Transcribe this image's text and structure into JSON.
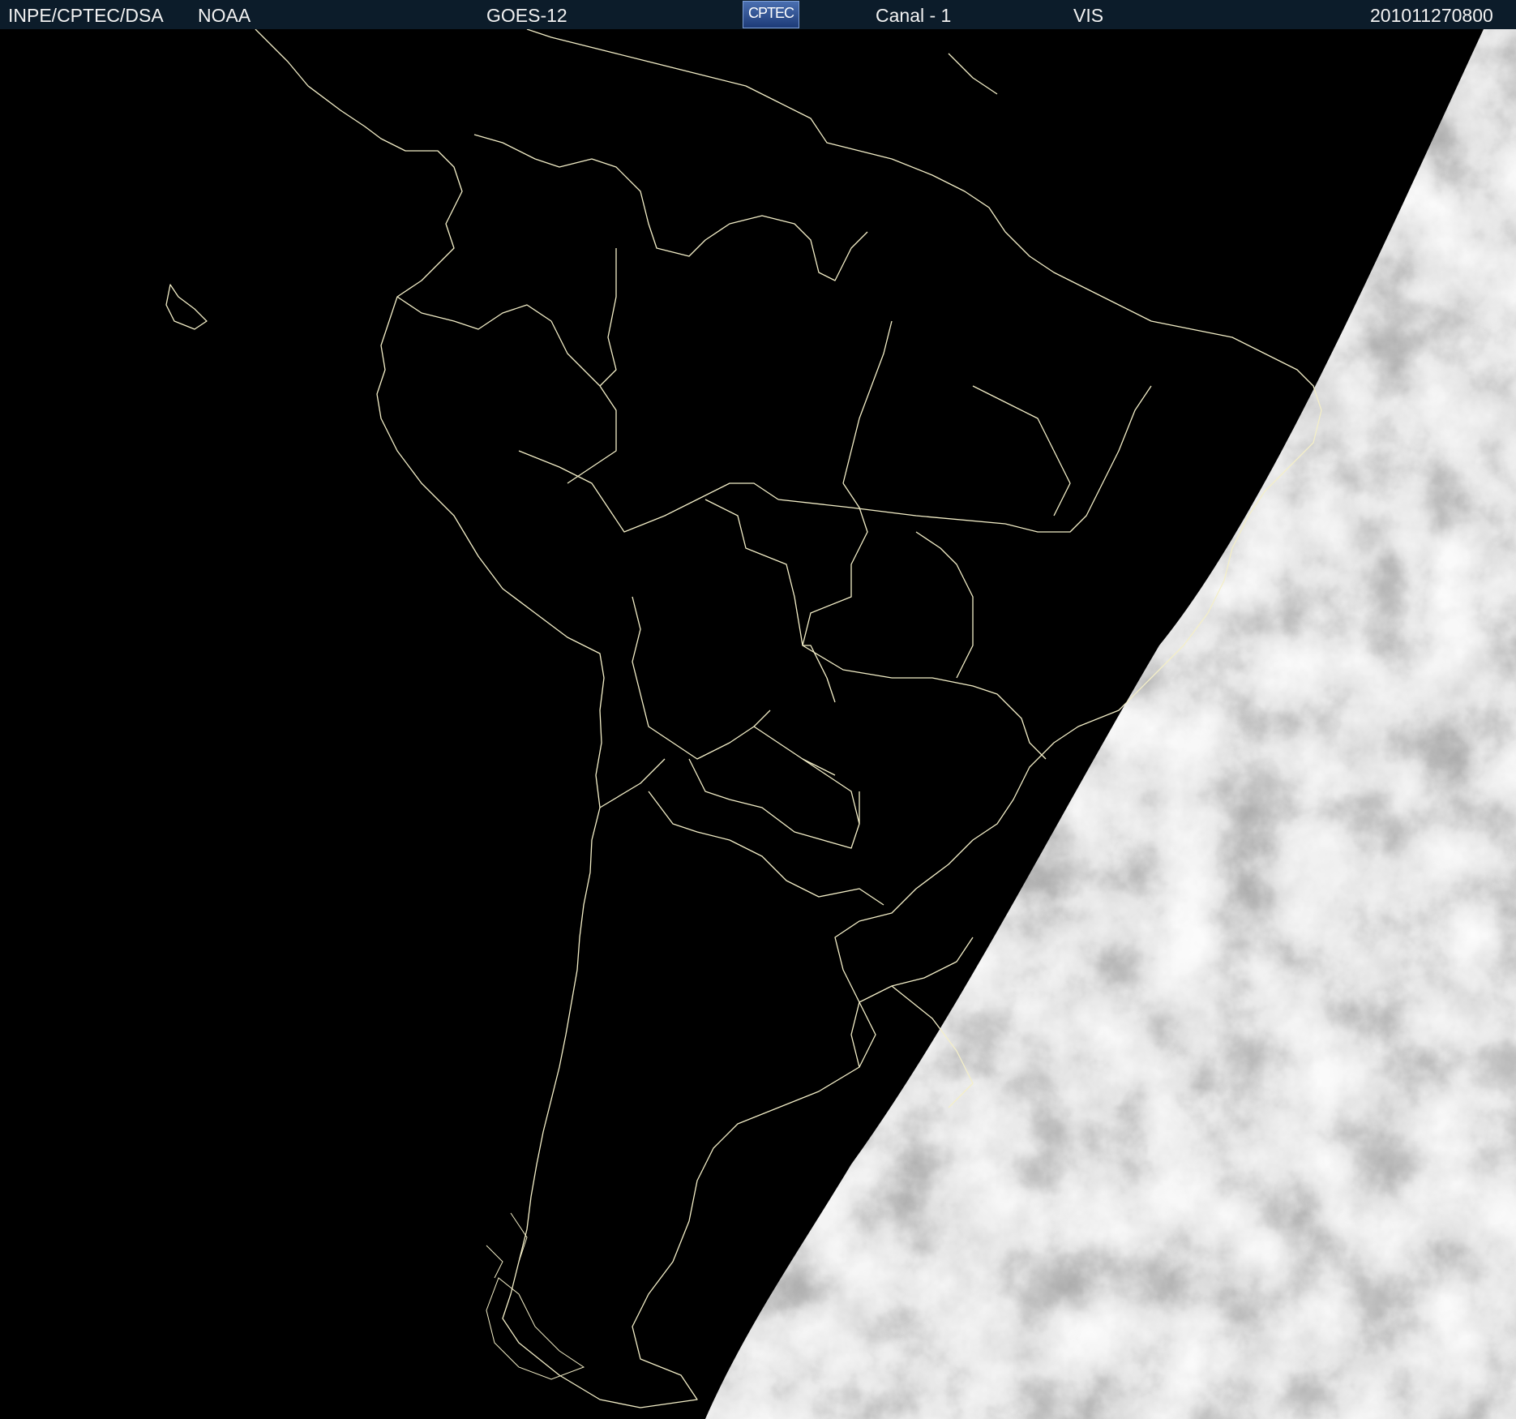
{
  "header": {
    "source": "INPE/CPTEC/DSA",
    "agency": "NOAA",
    "satellite": "GOES-12",
    "logo_text": "CPTEC",
    "channel": "Canal - 1",
    "band": "VIS",
    "timestamp": "201011270800"
  },
  "colors": {
    "header_bg": "#0c1c2a",
    "header_text": "#f2f2f2",
    "background": "#000000",
    "coastline": "#f4efc8",
    "cloud_white": "#e8e8e8",
    "ocean_gray": "#6e6e6e"
  },
  "icons": {
    "logo": "cptec-logo"
  }
}
